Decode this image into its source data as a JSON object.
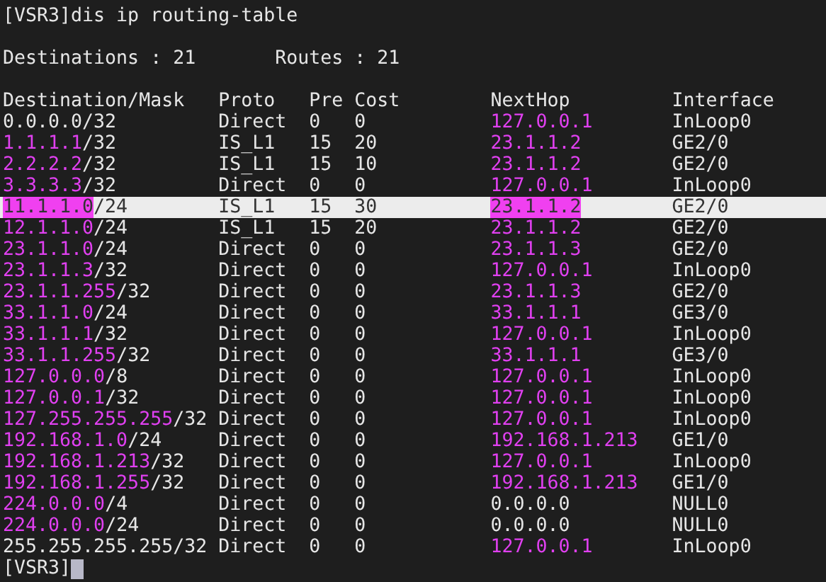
{
  "command_line": {
    "prompt": "[VSR3]",
    "command": "dis ip routing-table"
  },
  "summary": {
    "destinations_label": "Destinations :",
    "destinations": "21",
    "routes_label": "Routes :",
    "routes": "21"
  },
  "table": {
    "columns": [
      "Destination/Mask",
      "Proto",
      "Pre",
      "Cost",
      "NextHop",
      "Interface"
    ],
    "rows": [
      {
        "dest_ip": "0.0.0.0",
        "dest_mask": "/32",
        "dest_marked": false,
        "proto": "Direct",
        "pre": "0",
        "cost": "0",
        "nexthop": "127.0.0.1",
        "nexthop_marked": true,
        "interface": "InLoop0",
        "selected": false
      },
      {
        "dest_ip": "1.1.1.1",
        "dest_mask": "/32",
        "dest_marked": true,
        "proto": "IS_L1",
        "pre": "15",
        "cost": "20",
        "nexthop": "23.1.1.2",
        "nexthop_marked": true,
        "interface": "GE2/0",
        "selected": false
      },
      {
        "dest_ip": "2.2.2.2",
        "dest_mask": "/32",
        "dest_marked": true,
        "proto": "IS_L1",
        "pre": "15",
        "cost": "10",
        "nexthop": "23.1.1.2",
        "nexthop_marked": true,
        "interface": "GE2/0",
        "selected": false
      },
      {
        "dest_ip": "3.3.3.3",
        "dest_mask": "/32",
        "dest_marked": true,
        "proto": "Direct",
        "pre": "0",
        "cost": "0",
        "nexthop": "127.0.0.1",
        "nexthop_marked": true,
        "interface": "InLoop0",
        "selected": false
      },
      {
        "dest_ip": "11.1.1.0",
        "dest_mask": "/24",
        "dest_marked": true,
        "proto": "IS_L1",
        "pre": "15",
        "cost": "30",
        "nexthop": "23.1.1.2",
        "nexthop_marked": true,
        "interface": "GE2/0",
        "selected": true
      },
      {
        "dest_ip": "12.1.1.0",
        "dest_mask": "/24",
        "dest_marked": true,
        "proto": "IS_L1",
        "pre": "15",
        "cost": "20",
        "nexthop": "23.1.1.2",
        "nexthop_marked": true,
        "interface": "GE2/0",
        "selected": false
      },
      {
        "dest_ip": "23.1.1.0",
        "dest_mask": "/24",
        "dest_marked": true,
        "proto": "Direct",
        "pre": "0",
        "cost": "0",
        "nexthop": "23.1.1.3",
        "nexthop_marked": true,
        "interface": "GE2/0",
        "selected": false
      },
      {
        "dest_ip": "23.1.1.3",
        "dest_mask": "/32",
        "dest_marked": true,
        "proto": "Direct",
        "pre": "0",
        "cost": "0",
        "nexthop": "127.0.0.1",
        "nexthop_marked": true,
        "interface": "InLoop0",
        "selected": false
      },
      {
        "dest_ip": "23.1.1.255",
        "dest_mask": "/32",
        "dest_marked": true,
        "proto": "Direct",
        "pre": "0",
        "cost": "0",
        "nexthop": "23.1.1.3",
        "nexthop_marked": true,
        "interface": "GE2/0",
        "selected": false
      },
      {
        "dest_ip": "33.1.1.0",
        "dest_mask": "/24",
        "dest_marked": true,
        "proto": "Direct",
        "pre": "0",
        "cost": "0",
        "nexthop": "33.1.1.1",
        "nexthop_marked": true,
        "interface": "GE3/0",
        "selected": false
      },
      {
        "dest_ip": "33.1.1.1",
        "dest_mask": "/32",
        "dest_marked": true,
        "proto": "Direct",
        "pre": "0",
        "cost": "0",
        "nexthop": "127.0.0.1",
        "nexthop_marked": true,
        "interface": "InLoop0",
        "selected": false
      },
      {
        "dest_ip": "33.1.1.255",
        "dest_mask": "/32",
        "dest_marked": true,
        "proto": "Direct",
        "pre": "0",
        "cost": "0",
        "nexthop": "33.1.1.1",
        "nexthop_marked": true,
        "interface": "GE3/0",
        "selected": false
      },
      {
        "dest_ip": "127.0.0.0",
        "dest_mask": "/8",
        "dest_marked": true,
        "proto": "Direct",
        "pre": "0",
        "cost": "0",
        "nexthop": "127.0.0.1",
        "nexthop_marked": true,
        "interface": "InLoop0",
        "selected": false
      },
      {
        "dest_ip": "127.0.0.1",
        "dest_mask": "/32",
        "dest_marked": true,
        "proto": "Direct",
        "pre": "0",
        "cost": "0",
        "nexthop": "127.0.0.1",
        "nexthop_marked": true,
        "interface": "InLoop0",
        "selected": false
      },
      {
        "dest_ip": "127.255.255.255",
        "dest_mask": "/32",
        "dest_marked": true,
        "proto": "Direct",
        "pre": "0",
        "cost": "0",
        "nexthop": "127.0.0.1",
        "nexthop_marked": true,
        "interface": "InLoop0",
        "selected": false
      },
      {
        "dest_ip": "192.168.1.0",
        "dest_mask": "/24",
        "dest_marked": true,
        "proto": "Direct",
        "pre": "0",
        "cost": "0",
        "nexthop": "192.168.1.213",
        "nexthop_marked": true,
        "interface": "GE1/0",
        "selected": false
      },
      {
        "dest_ip": "192.168.1.213",
        "dest_mask": "/32",
        "dest_marked": true,
        "proto": "Direct",
        "pre": "0",
        "cost": "0",
        "nexthop": "127.0.0.1",
        "nexthop_marked": true,
        "interface": "InLoop0",
        "selected": false
      },
      {
        "dest_ip": "192.168.1.255",
        "dest_mask": "/32",
        "dest_marked": true,
        "proto": "Direct",
        "pre": "0",
        "cost": "0",
        "nexthop": "192.168.1.213",
        "nexthop_marked": true,
        "interface": "GE1/0",
        "selected": false
      },
      {
        "dest_ip": "224.0.0.0",
        "dest_mask": "/4",
        "dest_marked": true,
        "proto": "Direct",
        "pre": "0",
        "cost": "0",
        "nexthop": "0.0.0.0",
        "nexthop_marked": false,
        "interface": "NULL0",
        "selected": false
      },
      {
        "dest_ip": "224.0.0.0",
        "dest_mask": "/24",
        "dest_marked": true,
        "proto": "Direct",
        "pre": "0",
        "cost": "0",
        "nexthop": "0.0.0.0",
        "nexthop_marked": false,
        "interface": "NULL0",
        "selected": false
      },
      {
        "dest_ip": "255.255.255.255",
        "dest_mask": "/32",
        "dest_marked": false,
        "proto": "Direct",
        "pre": "0",
        "cost": "0",
        "nexthop": "127.0.0.1",
        "nexthop_marked": true,
        "interface": "InLoop0",
        "selected": false
      }
    ]
  },
  "input_line": {
    "prompt": "[VSR3]"
  }
}
